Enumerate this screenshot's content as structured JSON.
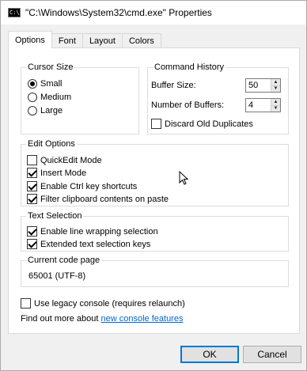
{
  "window": {
    "title": "\"C:\\Windows\\System32\\cmd.exe\" Properties",
    "icon_text": "C:\\"
  },
  "tabs": [
    {
      "label": "Options",
      "active": true
    },
    {
      "label": "Font",
      "active": false
    },
    {
      "label": "Layout",
      "active": false
    },
    {
      "label": "Colors",
      "active": false
    }
  ],
  "cursor_size": {
    "label": "Cursor Size",
    "options": [
      {
        "label": "Small",
        "checked": true
      },
      {
        "label": "Medium",
        "checked": false
      },
      {
        "label": "Large",
        "checked": false
      }
    ]
  },
  "command_history": {
    "label": "Command History",
    "buffer_size_label": "Buffer Size:",
    "buffer_size_value": "50",
    "num_buffers_label": "Number of Buffers:",
    "num_buffers_value": "4",
    "discard_label": "Discard Old Duplicates",
    "discard_checked": false
  },
  "edit_options": {
    "label": "Edit Options",
    "items": [
      {
        "label": "QuickEdit Mode",
        "checked": false
      },
      {
        "label": "Insert Mode",
        "checked": true
      },
      {
        "label": "Enable Ctrl key shortcuts",
        "checked": true
      },
      {
        "label": "Filter clipboard contents on paste",
        "checked": true
      }
    ]
  },
  "text_selection": {
    "label": "Text Selection",
    "items": [
      {
        "label": "Enable line wrapping selection",
        "checked": true
      },
      {
        "label": "Extended text selection keys",
        "checked": true
      }
    ]
  },
  "code_page": {
    "label": "Current code page",
    "value": "65001 (UTF-8)"
  },
  "legacy": {
    "label": "Use legacy console (requires relaunch)",
    "checked": false
  },
  "find_out": {
    "text": "Find out more about ",
    "link": "new console features"
  },
  "buttons": {
    "ok": "OK",
    "cancel": "Cancel"
  }
}
